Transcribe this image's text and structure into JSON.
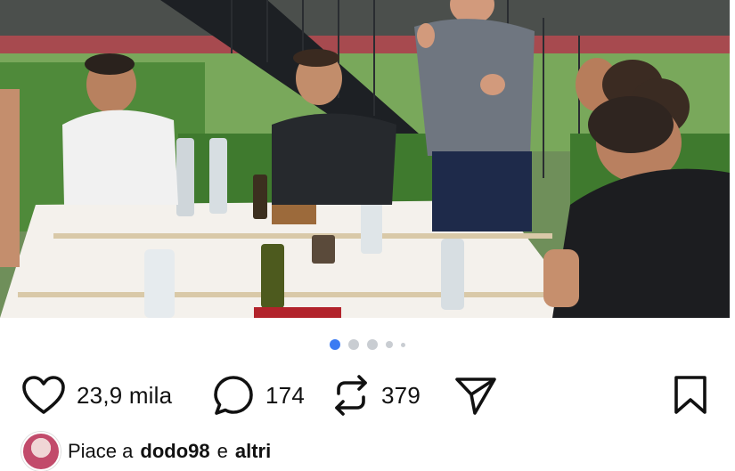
{
  "post": {
    "carousel": {
      "total": 5,
      "active_index": 0
    },
    "actions": {
      "like": {
        "icon": "heart-outline-icon",
        "count": "23,9 mila"
      },
      "comment": {
        "icon": "comment-bubble-icon",
        "count": "174"
      },
      "repost": {
        "icon": "repost-arrows-icon",
        "count": "379"
      },
      "share": {
        "icon": "paper-plane-icon"
      },
      "save": {
        "icon": "bookmark-outline-icon"
      }
    },
    "liked_by": {
      "prefix": "Piace a",
      "user": "dodo98",
      "connector": "e",
      "others": "altri"
    }
  },
  "colors": {
    "active_dot": "#3b7bf3",
    "inactive_dot": "#c9cdd2",
    "text": "#111111"
  }
}
